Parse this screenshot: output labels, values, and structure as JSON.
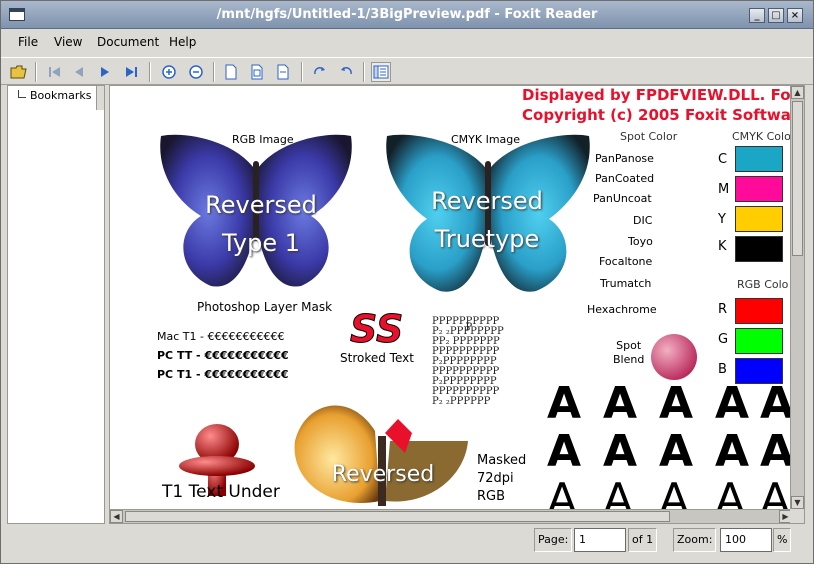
{
  "window": {
    "title": "/mnt/hgfs/Untitled-1/3BigPreview.pdf - Foxit Reader",
    "min_glyph": "_",
    "max_glyph": "□",
    "close_glyph": "×"
  },
  "menu": {
    "file": "File",
    "view": "View",
    "document": "Document",
    "help": "Help"
  },
  "toolbar": {
    "icons": [
      "open-folder-icon",
      "first-page-icon",
      "prev-page-icon",
      "next-page-icon",
      "last-page-icon",
      "zoom-in-icon",
      "zoom-out-icon",
      "actual-size-icon",
      "fit-page-icon",
      "fit-width-icon",
      "rotate-cw-icon",
      "rotate-ccw-icon",
      "bookmarks-panel-icon"
    ]
  },
  "sidebar": {
    "bookmarks_label": "Bookmarks"
  },
  "page": {
    "header_line1": "Displayed by FPDFVIEW.DLL. Fo",
    "header_line2": "Copyright (c) 2005 Foxit Software",
    "rgb_image_label": "RGB Image",
    "cmyk_image_label": "CMYK Image",
    "bfly1_text": "Reversed\nType 1",
    "bfly2_text": "Reversed\nTruetype",
    "photoshop_label": "Photoshop Layer Mask",
    "spot_color_label": "Spot Color",
    "cmyk_color_label": "CMYK Colo",
    "spot_names": [
      "PanPanose",
      "PanCoated",
      "PanUncoat",
      "DIC",
      "Toyo",
      "Focaltone",
      "Trumatch",
      "Hexachrome"
    ],
    "cmyk_letters": [
      "C",
      "M",
      "Y",
      "K"
    ],
    "cmyk_colors": [
      "#1aa6c4",
      "#ff0a9a",
      "#ffcd00",
      "#000000"
    ],
    "rgb_color_label": "RGB Colo",
    "rgb_letters": [
      "R",
      "G",
      "B"
    ],
    "rgb_colors": [
      "#ff0000",
      "#00ff00",
      "#0000ff"
    ],
    "mac_t1": "Mac T1 - €€€€€€€€€€€",
    "pc_tt": "PC TT - €€€€€€€€€€€",
    "pc_t1": "PC T1 - €€€€€€€€€€€",
    "ss_text": "SS",
    "stroked_text": "Stroked Text",
    "spot_blend_label": "Spot\nBlend",
    "t1_text_under": "T1 Text Under",
    "reversed_text": "Reversed",
    "masked_label": "Masked\n72dpi\nRGB",
    "p_glyph": "P",
    "sub_glyph": "2",
    "a_glyph": "A"
  },
  "status": {
    "page_label": "Page:",
    "page_value": "1",
    "of_label": "of 1",
    "zoom_label": "Zoom:",
    "zoom_value": "100",
    "percent": "%"
  }
}
